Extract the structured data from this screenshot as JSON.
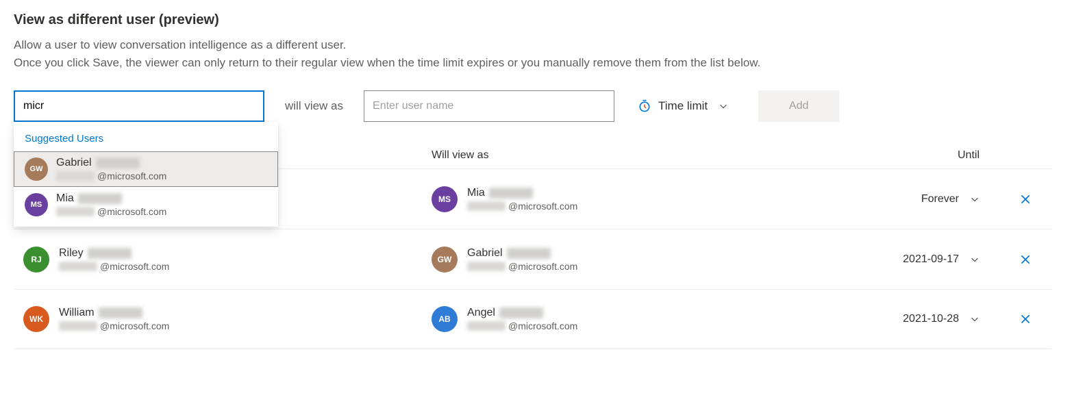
{
  "title": "View as different user (preview)",
  "description": "Allow a user to view conversation intelligence as a different user.\nOnce you click Save, the viewer can only return to their regular view when the time limit expires or you manually remove them from the list below.",
  "form": {
    "viewer_input_value": "micr",
    "viewer_input_placeholder": "",
    "will_view_as_label": "will view as",
    "target_input_placeholder": "Enter user name",
    "time_limit_label": "Time limit",
    "add_button_label": "Add"
  },
  "dropdown": {
    "header": "Suggested Users",
    "items": [
      {
        "name_visible": "Gabriel",
        "email_suffix": "@microsoft.com",
        "initials": "GW",
        "avatar_color": "#a67b5b",
        "selected": true
      },
      {
        "name_visible": "Mia",
        "email_suffix": "@microsoft.com",
        "initials": "MS",
        "avatar_color": "#6b3fa0",
        "selected": false
      }
    ]
  },
  "table": {
    "headers": {
      "view_as": "Will view as",
      "until": "Until"
    },
    "rows": [
      {
        "viewer": {
          "name_visible": "",
          "email_suffix": "",
          "initials": "",
          "avatar_color": "",
          "hidden_by_dropdown": true
        },
        "view_as": {
          "name_visible": "Mia",
          "email_suffix": "@microsoft.com",
          "initials": "MS",
          "avatar_color": "#6b3fa0"
        },
        "until": "Forever"
      },
      {
        "viewer": {
          "name_visible": "Riley",
          "email_suffix": "@microsoft.com",
          "initials": "RJ",
          "avatar_color": "#3a8f2e"
        },
        "view_as": {
          "name_visible": "Gabriel",
          "email_suffix": "@microsoft.com",
          "initials": "GW",
          "avatar_color": "#a67b5b"
        },
        "until": "2021-09-17"
      },
      {
        "viewer": {
          "name_visible": "William",
          "email_suffix": "@microsoft.com",
          "initials": "WK",
          "avatar_color": "#d85a1f"
        },
        "view_as": {
          "name_visible": "Angel",
          "email_suffix": "@microsoft.com",
          "initials": "AB",
          "avatar_color": "#2f7cd6"
        },
        "until": "2021-10-28"
      }
    ]
  }
}
